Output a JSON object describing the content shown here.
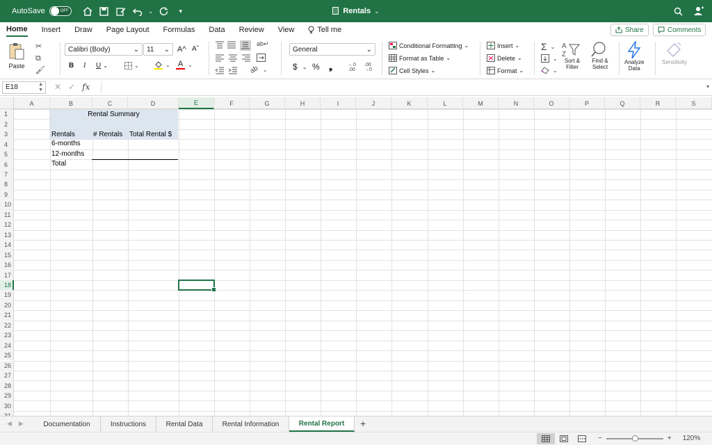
{
  "titlebar": {
    "autosave_label": "AutoSave",
    "autosave_state": "OFF",
    "doc_title": "Rentals",
    "title_chevron": "⌄"
  },
  "ribbon_tabs": [
    "Home",
    "Insert",
    "Draw",
    "Page Layout",
    "Formulas",
    "Data",
    "Review",
    "View"
  ],
  "tell_me": "Tell me",
  "share_label": "Share",
  "comments_label": "Comments",
  "ribbon": {
    "paste": "Paste",
    "font_name": "Calibri (Body)",
    "font_size": "11",
    "number_format": "General",
    "conditional_formatting": "Conditional Formatting",
    "format_as_table": "Format as Table",
    "cell_styles": "Cell Styles",
    "insert": "Insert",
    "delete": "Delete",
    "format": "Format",
    "sort_filter_1": "Sort &",
    "sort_filter_2": "Filter",
    "find_select_1": "Find &",
    "find_select_2": "Select",
    "analyze_data_1": "Analyze",
    "analyze_data_2": "Data",
    "sensitivity": "Sensitivity",
    "bold": "B",
    "italic": "I",
    "underline": "U",
    "dollar": "$",
    "percent": "%",
    "comma": "❟",
    "grow_font": "A^",
    "shrink_font": "Aˇ",
    "font_color_letter": "A"
  },
  "formula_bar": {
    "name_box": "E18",
    "fx": "fx",
    "formula": ""
  },
  "columns": [
    "A",
    "B",
    "C",
    "D",
    "E",
    "F",
    "G",
    "H",
    "I",
    "J",
    "K",
    "L",
    "M",
    "N",
    "O",
    "P",
    "Q",
    "R",
    "S"
  ],
  "rows": [
    "1",
    "2",
    "3",
    "4",
    "5",
    "6",
    "7",
    "8",
    "9",
    "10",
    "11",
    "12",
    "13",
    "14",
    "15",
    "16",
    "17",
    "18",
    "19",
    "20",
    "21",
    "22",
    "23",
    "24",
    "25",
    "26",
    "27",
    "28",
    "29",
    "30",
    "31"
  ],
  "selected_column": "E",
  "selected_row": "18",
  "cells": {
    "title": "Rental Summary",
    "hdr_rentals": "Rentals",
    "hdr_count": "# Rentals",
    "hdr_total": "Total Rental $",
    "row_6m": "6-months",
    "row_12m": "12-months",
    "row_total": "Total"
  },
  "sheets": [
    "Documentation",
    "Instructions",
    "Rental Data",
    "Rental Information",
    "Rental Report"
  ],
  "active_sheet": "Rental Report",
  "add_sheet": "+",
  "zoom": "120%",
  "zoom_fraction": 0.5,
  "colors": {
    "accent": "#217346",
    "header_fill": "#dce6f1"
  }
}
